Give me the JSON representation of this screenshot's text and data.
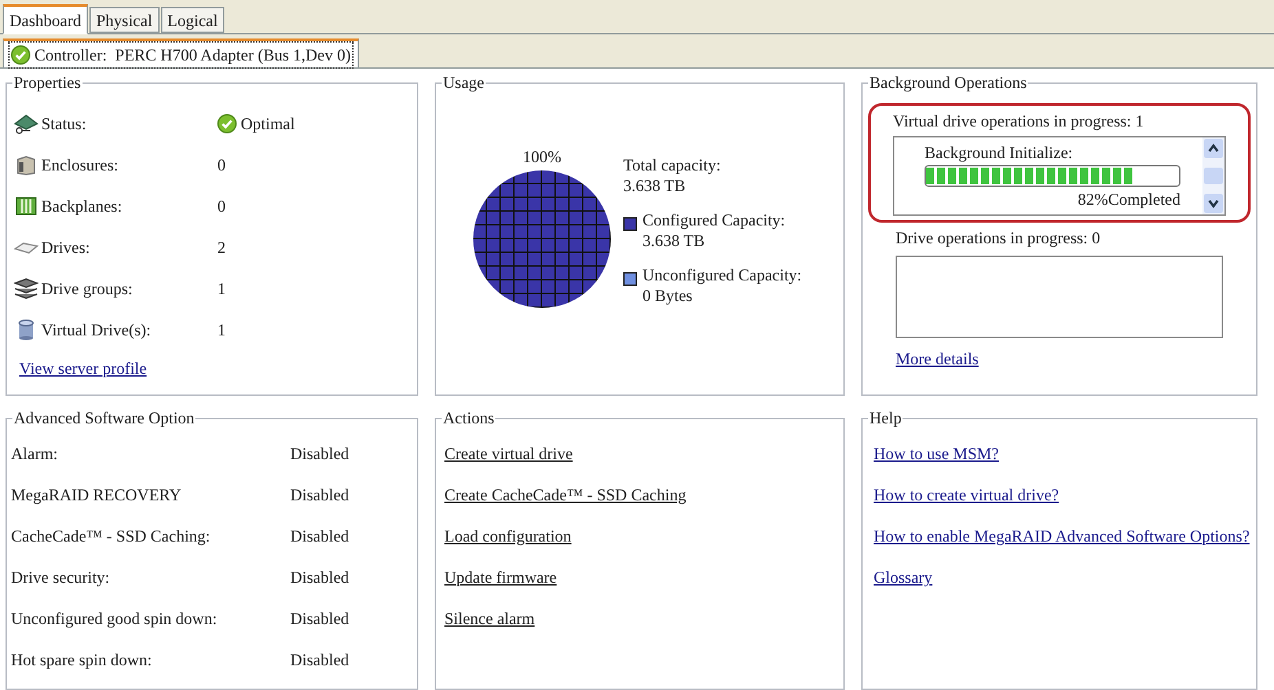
{
  "tabs": [
    {
      "label": "Dashboard",
      "selected": true
    },
    {
      "label": "Physical",
      "selected": false
    },
    {
      "label": "Logical",
      "selected": false
    }
  ],
  "controller_tab": {
    "label": "Controller:  PERC H700 Adapter (Bus 1,Dev 0)"
  },
  "properties": {
    "title": "Properties",
    "rows": [
      {
        "kind": "status",
        "label": "Status:",
        "value": "Optimal"
      },
      {
        "kind": "enclosure",
        "label": "Enclosures:",
        "value": "0"
      },
      {
        "kind": "backplane",
        "label": "Backplanes:",
        "value": "0"
      },
      {
        "kind": "drive",
        "label": "Drives:",
        "value": "2"
      },
      {
        "kind": "group",
        "label": "Drive groups:",
        "value": "1"
      },
      {
        "kind": "virtual",
        "label": "Virtual Drive(s):",
        "value": "1"
      }
    ],
    "link": "View server profile"
  },
  "usage": {
    "title": "Usage",
    "total_label": "Total capacity:",
    "total_value": "3.638 TB",
    "legend": [
      {
        "label": "Configured Capacity:",
        "value": "3.638 TB",
        "color": "#3a35a8"
      },
      {
        "label": "Unconfigured Capacity:",
        "value": "0 Bytes",
        "color": "#6f8fe0"
      }
    ],
    "pie_label": "100%"
  },
  "background_operations": {
    "title": "Background Operations",
    "vd_label": "Virtual drive operations in progress: 1",
    "operation": {
      "name": "Background Initialize:",
      "level": 0.82,
      "reading": "82%Completed"
    },
    "drive_label": "Drive operations in progress: 0",
    "link": "More details"
  },
  "advanced_software_option": {
    "title": "Advanced Software Option",
    "rows": [
      {
        "label": "Alarm:",
        "value": "Disabled"
      },
      {
        "label": "MegaRAID RECOVERY",
        "value": "Disabled"
      },
      {
        "label": "CacheCade™ - SSD Caching:",
        "value": "Disabled"
      },
      {
        "label": "Drive security:",
        "value": "Disabled"
      },
      {
        "label": "Unconfigured good spin down:",
        "value": "Disabled"
      },
      {
        "label": "Hot spare spin down:",
        "value": "Disabled"
      }
    ]
  },
  "actions": {
    "title": "Actions",
    "links": [
      "Create virtual drive",
      "Create CacheCade™ - SSD Caching",
      "Load configuration",
      "Update firmware",
      "Silence alarm"
    ]
  },
  "help": {
    "title": "Help",
    "links": [
      "How to use MSM?",
      "How to create virtual drive?",
      "How to enable MegaRAID Advanced Software Options?",
      "Glossary"
    ]
  }
}
